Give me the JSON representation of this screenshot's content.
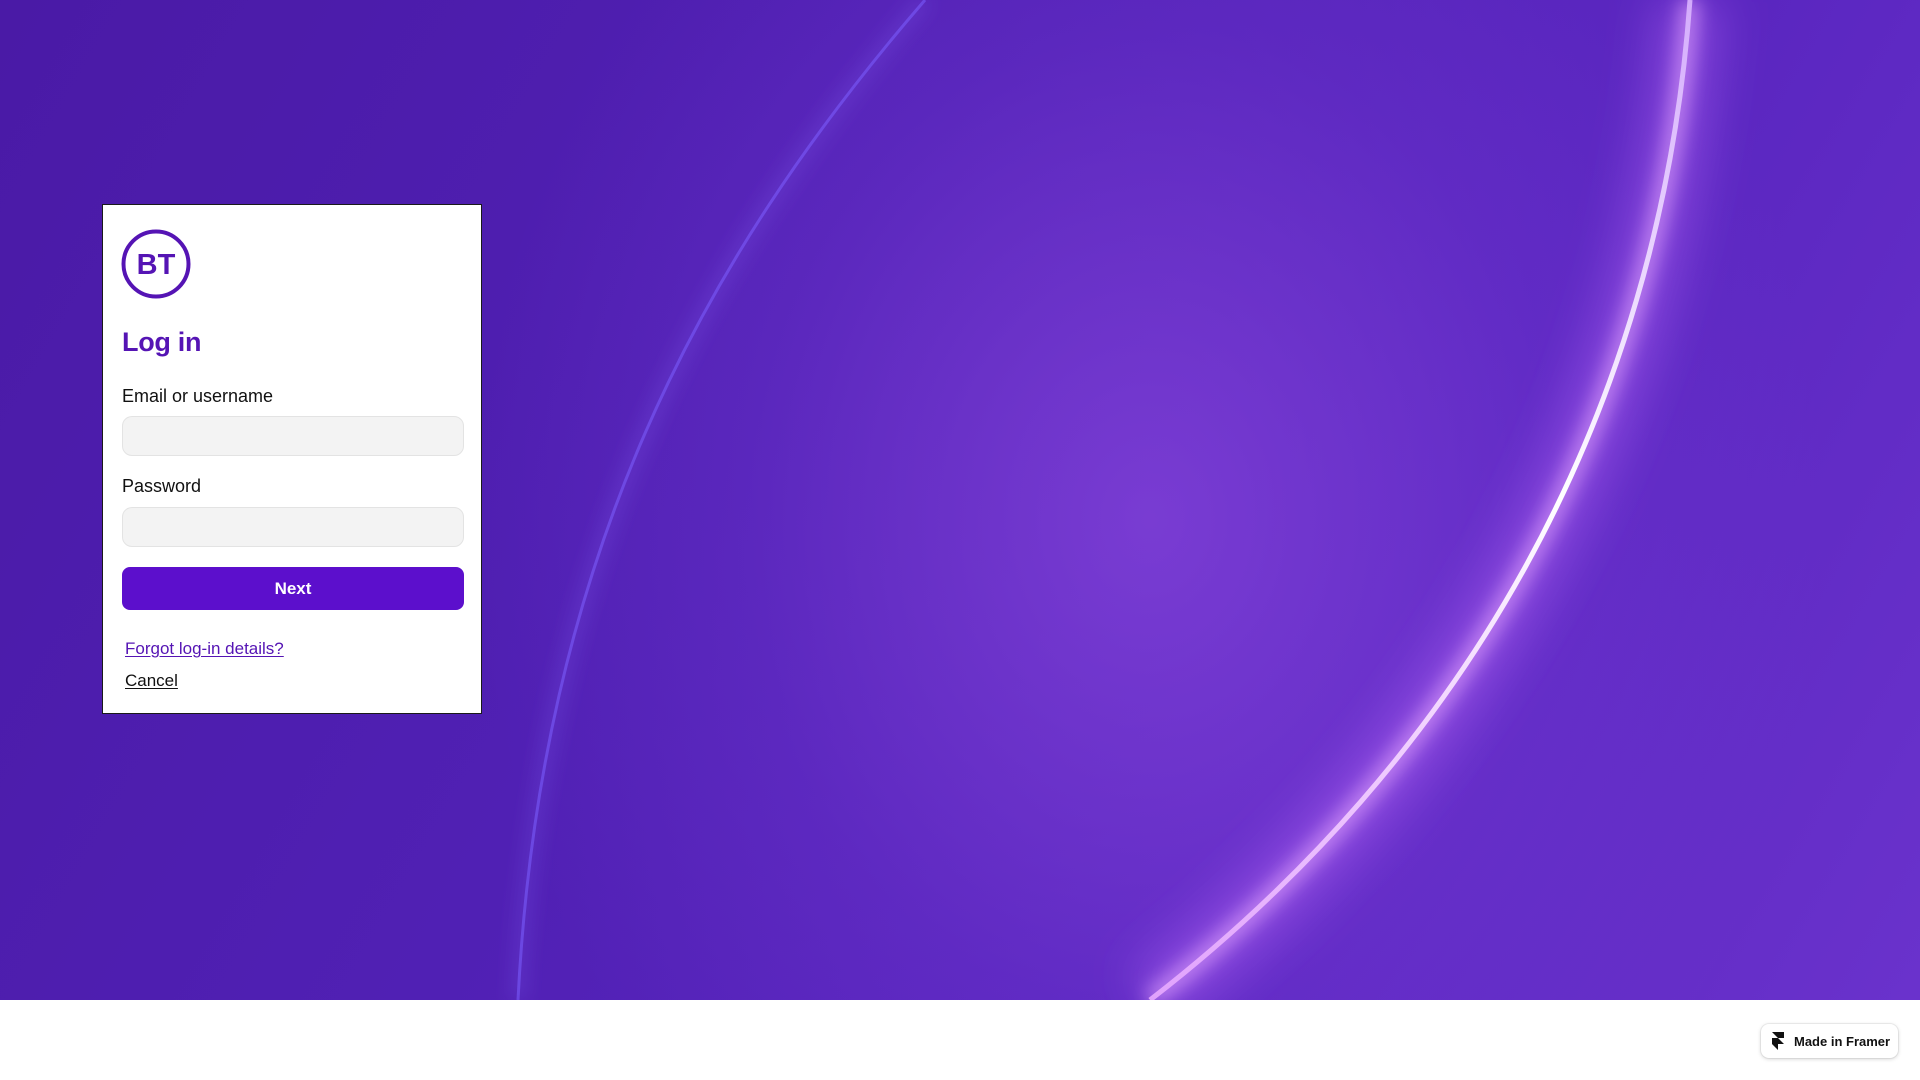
{
  "login": {
    "logo_text": "BT",
    "title": "Log in",
    "email_label": "Email or username",
    "email_value": "",
    "password_label": "Password",
    "password_value": "",
    "next_label": "Next",
    "forgot_label": "Forgot log-in details?",
    "cancel_label": "Cancel"
  },
  "badge": {
    "label": "Made in Framer",
    "icon": "framer-logo-icon"
  },
  "colors": {
    "brand_purple": "#5514b4",
    "button_purple": "#5c0fcc",
    "background_purple": "#4f1fb0"
  }
}
